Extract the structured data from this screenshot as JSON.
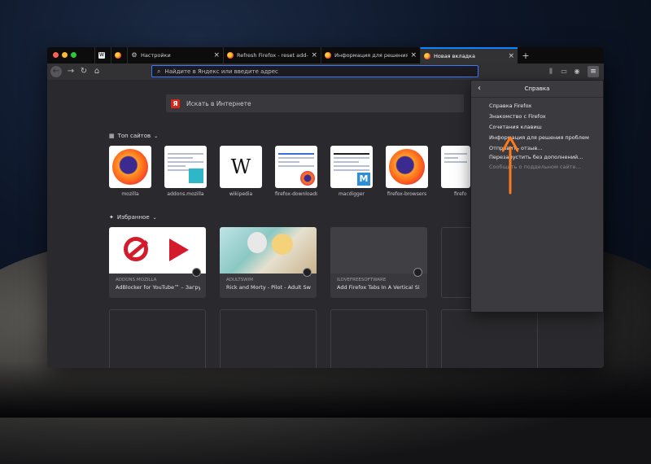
{
  "tabs": [
    {
      "label": "",
      "icon": "wikipedia-icon"
    },
    {
      "label": "",
      "icon": "firefox-icon"
    },
    {
      "label": "Настройки",
      "icon": "gear-icon"
    },
    {
      "label": "Refresh Firefox - reset add-on",
      "icon": "firefox-icon"
    },
    {
      "label": "Информация для решения пр",
      "icon": "firefox-icon"
    },
    {
      "label": "Новая вкладка",
      "icon": "firefox-icon"
    }
  ],
  "toolbar": {
    "url_placeholder": "Найдите в Яндекс или введите адрес"
  },
  "newtab": {
    "search_placeholder": "Искать в Интернете",
    "search_engine_letter": "Я",
    "top_sites_title": "Топ сайтов",
    "highlights_title": "Избранное",
    "top_sites": [
      {
        "name": "mozilla"
      },
      {
        "name": "addons.mozilla"
      },
      {
        "name": "wikipedia"
      },
      {
        "name": "firefox-downloads"
      },
      {
        "name": "macdigger"
      },
      {
        "name": "firefox-browsers"
      },
      {
        "name": "firefo"
      }
    ],
    "highlights": [
      {
        "source": "ADDONS.MOZILLA",
        "title": "AdBlocker for YouTube™ – Загру"
      },
      {
        "source": "ADULTSWIM",
        "title": "Rick and Morty - Pilot - Adult Sw"
      },
      {
        "source": "ILOVEFREESOFTWARE",
        "title": "Add Firefox Tabs In A Vertical Si"
      }
    ]
  },
  "help_panel": {
    "title": "Справка",
    "items": [
      {
        "label": "Справка Firefox",
        "disabled": false
      },
      {
        "label": "Знакомство с Firefox",
        "disabled": false
      },
      {
        "label": "Сочетания клавиш",
        "disabled": false
      },
      {
        "label": "Информация для решения проблем",
        "disabled": false
      },
      {
        "label": "Отправить отзыв...",
        "disabled": false
      },
      {
        "label": "Перезапустить без дополнений...",
        "disabled": false
      },
      {
        "label": "Сообщить о поддельном сайте...",
        "disabled": true
      }
    ]
  },
  "colors": {
    "accent": "#0a84ff",
    "annotation_arrow": "#ff7a1a"
  }
}
